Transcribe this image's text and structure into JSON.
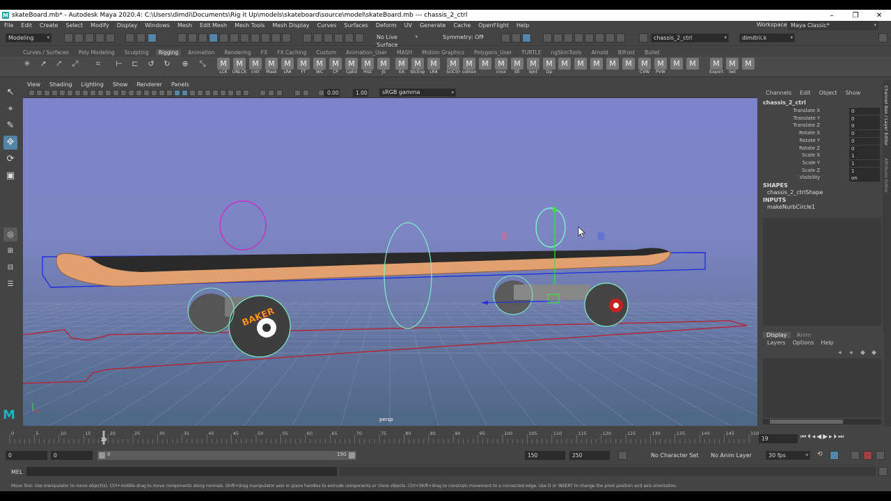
{
  "window": {
    "title": "skateBoard.mb* - Autodesk Maya 2020.4: C:\\Users\\dimdi\\Documents\\Rig it Up\\models\\skateboard\\source\\model\\skateBoard.mb   ---   chassis_2_ctrl",
    "logo": "M",
    "buttons": [
      "–",
      "❐",
      "✕"
    ]
  },
  "menu": [
    "File",
    "Edit",
    "Create",
    "Select",
    "Modify",
    "Display",
    "Windows",
    "Mesh",
    "Edit Mesh",
    "Mesh Tools",
    "Mesh Display",
    "Curves",
    "Surfaces",
    "Deform",
    "UV",
    "Generate",
    "Cache",
    "OpenFlight",
    "Help"
  ],
  "workspace": {
    "label": "Workspace :",
    "value": "Maya Classic*"
  },
  "status": {
    "mode": "Modeling",
    "live_surface": "No Live Surface",
    "symmetry": "Symmetry: Off",
    "object_field": "chassis_2_ctrl",
    "user": "dimitrii.k"
  },
  "shelf_tabs": [
    "Curves / Surfaces",
    "Poly Modeling",
    "Sculpting",
    "Rigging",
    "Animation",
    "Rendering",
    "FX",
    "FX Caching",
    "Custom",
    "Animation_User",
    "MASH",
    "Motion Graphics",
    "Polygons_User",
    "TURTLE",
    "ngSkinTools",
    "Arnold",
    "Bifrost",
    "Bullet"
  ],
  "active_shelf_tab": "Rigging",
  "shelf_labeled": [
    "LCK",
    "UNLCK",
    "cntr",
    "Mask",
    "LRA",
    "FT",
    "WC",
    "CP",
    "CpEd",
    "Hist",
    "JS",
    "EA",
    "btcExp",
    "LRA",
    "SclCtrl",
    "collisio",
    "",
    "cnvx",
    "EE",
    "bjnt",
    "Dp",
    "",
    "",
    "",
    "",
    "",
    "CVW",
    "PVW",
    "",
    "",
    "Export",
    "Set",
    ""
  ],
  "viewport_menu": [
    "View",
    "Shading",
    "Lighting",
    "Show",
    "Renderer",
    "Panels"
  ],
  "viewport_fields": {
    "near": "0.00",
    "far": "1.00",
    "colorspace": "sRGB gamma"
  },
  "camera_label": "persp",
  "board_text": "BAKER",
  "channel_menu": [
    "Channels",
    "Edit",
    "Object",
    "Show"
  ],
  "object_name": "chassis_2_ctrl",
  "channels": [
    {
      "label": "Translate X",
      "value": "0"
    },
    {
      "label": "Translate Y",
      "value": "0"
    },
    {
      "label": "Translate Z",
      "value": "0"
    },
    {
      "label": "Rotate X",
      "value": "0"
    },
    {
      "label": "Rotate Y",
      "value": "0"
    },
    {
      "label": "Rotate Z",
      "value": "0"
    },
    {
      "label": "Scale X",
      "value": "1"
    },
    {
      "label": "Scale Y",
      "value": "1"
    },
    {
      "label": "Scale Z",
      "value": "1"
    },
    {
      "label": "Visibility",
      "value": "on"
    }
  ],
  "shapes": {
    "header": "SHAPES",
    "item": "chassis_2_ctrlShape"
  },
  "inputs": {
    "header": "INPUTS",
    "item": "makeNurbCircle1"
  },
  "side_tabs": [
    "Channel Box / Layer Editor",
    "Attribute Editor"
  ],
  "layer_tabs": [
    "Display",
    "Anim"
  ],
  "layer_menu": [
    "Layers",
    "Options",
    "Help"
  ],
  "timeline": {
    "ticks": [
      "0",
      "5",
      "10",
      "15",
      "20",
      "25",
      "30",
      "35",
      "40",
      "45",
      "50",
      "55",
      "60",
      "65",
      "70",
      "75",
      "80",
      "85",
      "90",
      "95",
      "100",
      "105",
      "110",
      "115",
      "120",
      "125",
      "130",
      "135",
      "140",
      "145",
      "150"
    ],
    "current_frame": "19",
    "playhead_marker": "19"
  },
  "range": {
    "start": "0",
    "anim_start": "0",
    "slider_start": "0",
    "slider_end": "150",
    "end": "150",
    "anim_end": "250",
    "character_set": "No Character Set",
    "anim_layer": "No Anim Layer",
    "fps": "30 fps"
  },
  "cmd": {
    "label": "MEL"
  },
  "help": "Move Tool: Use manipulator to move object(s). Ctrl+middle-drag to move components along normals. Shift+drag manipulator axis or plane handles to extrude components or clone objects. Ctrl+Shift+drag to constrain movement to a connected edge. Use D or INSERT to change the pivot position and axis orientation.",
  "colors": {
    "accent": "#5285a6",
    "viewport_top": "#7f83cb",
    "viewport_bottom": "#4e6785",
    "board_wood": "#e0a070"
  }
}
